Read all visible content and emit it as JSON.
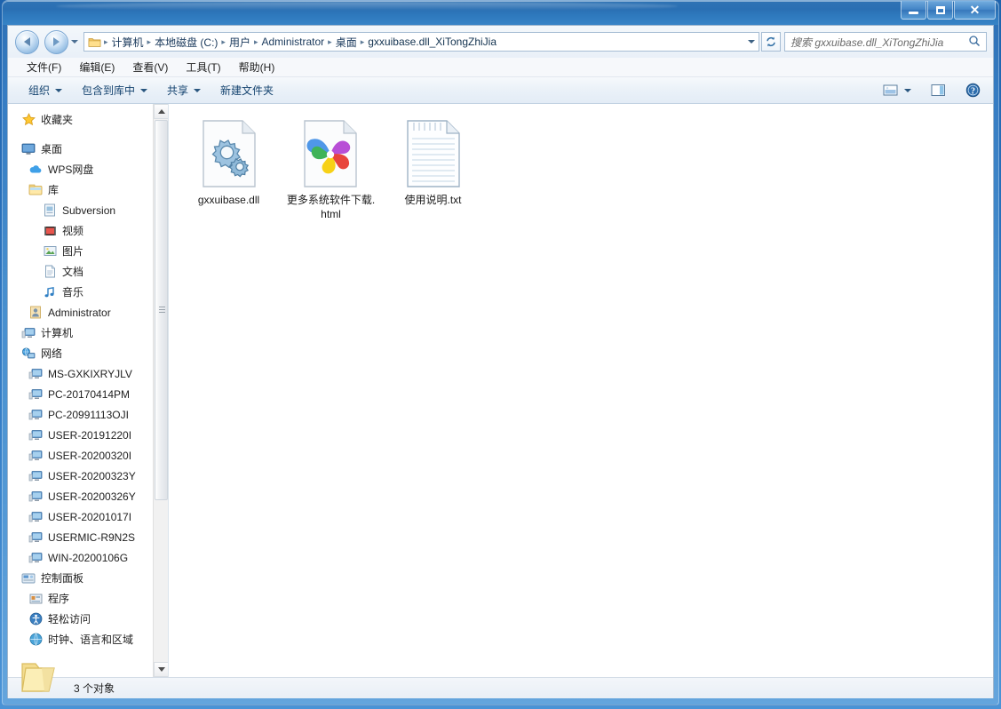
{
  "window": {
    "title": "",
    "caption_buttons": [
      {
        "name": "minimize",
        "glyph": "minimize"
      },
      {
        "name": "maximize",
        "glyph": "maximize"
      },
      {
        "name": "close",
        "glyph": "×"
      }
    ]
  },
  "navigation": {
    "back_tooltip": "后退",
    "forward_tooltip": "前进",
    "recent_dropdown": "最近浏览的位置",
    "refresh": "刷新"
  },
  "address": {
    "crumbs": [
      "计算机",
      "本地磁盘 (C:)",
      "用户",
      "Administrator",
      "桌面",
      "gxxuibase.dll_XiTongZhiJia"
    ],
    "separator": "▸"
  },
  "search": {
    "placeholder": "搜索 gxxuibase.dll_XiTongZhiJia",
    "value": "",
    "icon": "search-icon"
  },
  "menubar": {
    "items": [
      {
        "label": "文件(F)"
      },
      {
        "label": "编辑(E)"
      },
      {
        "label": "查看(V)"
      },
      {
        "label": "工具(T)"
      },
      {
        "label": "帮助(H)"
      }
    ]
  },
  "commandbar": {
    "items": [
      {
        "label": "组织",
        "has_caret": true
      },
      {
        "label": "包含到库中",
        "has_caret": true
      },
      {
        "label": "共享",
        "has_caret": true
      },
      {
        "label": "新建文件夹",
        "has_caret": false
      }
    ],
    "right_buttons": [
      {
        "name": "view-mode-button",
        "icon": "view-icon",
        "has_caret": true
      },
      {
        "name": "preview-pane-button",
        "icon": "preview-pane-icon",
        "has_caret": false
      },
      {
        "name": "help-button",
        "icon": "help-icon",
        "has_caret": false
      }
    ]
  },
  "sidebar": {
    "items": [
      {
        "label": "收藏夹",
        "icon": "star-icon",
        "indent": 0
      },
      {
        "label": "桌面",
        "icon": "desktop-icon",
        "indent": 0
      },
      {
        "label": "WPS网盘",
        "icon": "cloud-icon",
        "indent": 1
      },
      {
        "label": "库",
        "icon": "library-icon",
        "indent": 1
      },
      {
        "label": "Subversion",
        "icon": "subversion-icon",
        "indent": 2
      },
      {
        "label": "视频",
        "icon": "video-icon",
        "indent": 2
      },
      {
        "label": "图片",
        "icon": "pictures-icon",
        "indent": 2
      },
      {
        "label": "文档",
        "icon": "documents-icon",
        "indent": 2
      },
      {
        "label": "音乐",
        "icon": "music-icon",
        "indent": 2
      },
      {
        "label": "Administrator",
        "icon": "user-icon",
        "indent": 1
      },
      {
        "label": "计算机",
        "icon": "computer-icon",
        "indent": 0
      },
      {
        "label": "网络",
        "icon": "network-icon",
        "indent": 0
      },
      {
        "label": "MS-GXKIXRYJLV",
        "icon": "computer-icon",
        "indent": 1
      },
      {
        "label": "PC-20170414PM",
        "icon": "computer-icon",
        "indent": 1
      },
      {
        "label": "PC-20991113OJI",
        "icon": "computer-icon",
        "indent": 1
      },
      {
        "label": "USER-20191220I",
        "icon": "computer-icon",
        "indent": 1
      },
      {
        "label": "USER-20200320I",
        "icon": "computer-icon",
        "indent": 1
      },
      {
        "label": "USER-20200323Y",
        "icon": "computer-icon",
        "indent": 1
      },
      {
        "label": "USER-20200326Y",
        "icon": "computer-icon",
        "indent": 1
      },
      {
        "label": "USER-20201017I",
        "icon": "computer-icon",
        "indent": 1
      },
      {
        "label": "USERMIC-R9N2S",
        "icon": "computer-icon",
        "indent": 1
      },
      {
        "label": "WIN-20200106G",
        "icon": "computer-icon",
        "indent": 1
      },
      {
        "label": "控制面板",
        "icon": "control-panel-icon",
        "indent": 0
      },
      {
        "label": "程序",
        "icon": "programs-icon",
        "indent": 1
      },
      {
        "label": "轻松访问",
        "icon": "ease-of-access-icon",
        "indent": 1
      },
      {
        "label": "时钟、语言和区域",
        "icon": "clock-language-icon",
        "indent": 1
      }
    ]
  },
  "files": [
    {
      "name": "gxxuibase.dll",
      "icon": "gears-dll-icon"
    },
    {
      "name": "更多系统软件下载.html",
      "icon": "browser-html-icon"
    },
    {
      "name": "使用说明.txt",
      "icon": "text-file-icon"
    }
  ],
  "statusbar": {
    "text": "3 个对象",
    "icon": "folder-icon"
  },
  "colors": {
    "title_gradient_start": "#2f73b4",
    "title_gradient_end": "#3783c6",
    "desktop_background": "#2a72bd",
    "crumb_text": "#1b3a5c",
    "command_text": "#14436f"
  }
}
